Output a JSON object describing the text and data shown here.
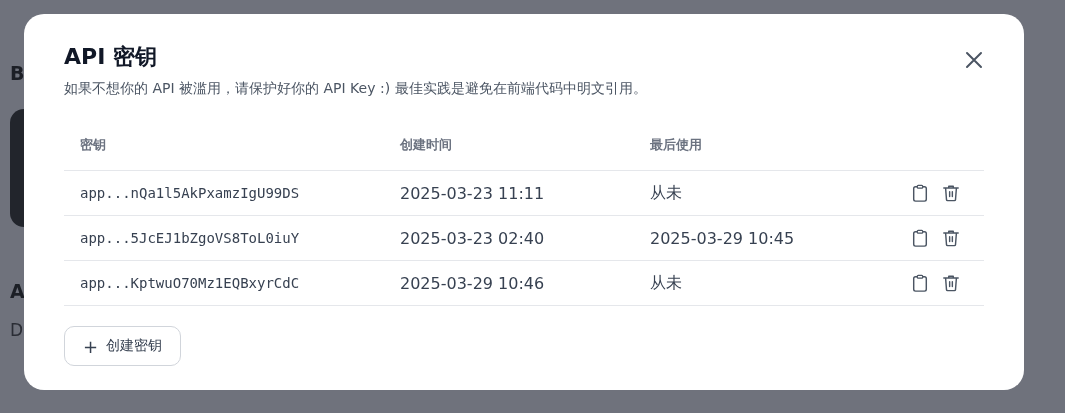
{
  "backdrop": {
    "texts": [
      "B",
      "A",
      "D"
    ]
  },
  "dialog": {
    "title": "API 密钥",
    "description": "如果不想你的 API 被滥用，请保护好你的 API Key :) 最佳实践是避免在前端代码中明文引用。",
    "table": {
      "columns": [
        "密钥",
        "创建时间",
        "最后使用"
      ],
      "rows": [
        {
          "key": "app...nQa1l5AkPxamzIgU99DS",
          "created": "2025-03-23 11:11",
          "last_used": "从未"
        },
        {
          "key": "app...5JcEJ1bZgoVS8ToL0iuY",
          "created": "2025-03-23 02:40",
          "last_used": "2025-03-29 10:45"
        },
        {
          "key": "app...KptwuO70Mz1EQBxyrCdC",
          "created": "2025-03-29 10:46",
          "last_used": "从未"
        }
      ]
    },
    "create_button": {
      "icon": "+",
      "label": "创建密钥"
    }
  }
}
